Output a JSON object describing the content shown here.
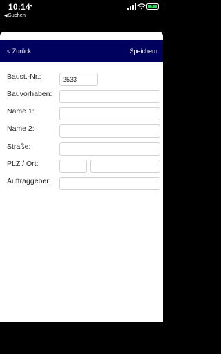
{
  "status_bar": {
    "time": "10:14",
    "back_app": "Suchen"
  },
  "nav": {
    "back_label": "< Zurück",
    "save_label": "Speichern",
    "color": "#00005e"
  },
  "form": {
    "baustelle_nr": {
      "label": "Baust.-Nr.:",
      "value": "2533"
    },
    "bauvorhaben": {
      "label": "Bauvorhaben:",
      "value": ""
    },
    "name1": {
      "label": "Name 1:",
      "value": ""
    },
    "name2": {
      "label": "Name 2:",
      "value": ""
    },
    "strasse": {
      "label": "Straße:",
      "value": ""
    },
    "plz_ort": {
      "label": "PLZ / Ort:",
      "plz_value": "",
      "ort_value": ""
    },
    "auftraggeber": {
      "label": "Auftraggeber:",
      "value": ""
    }
  }
}
